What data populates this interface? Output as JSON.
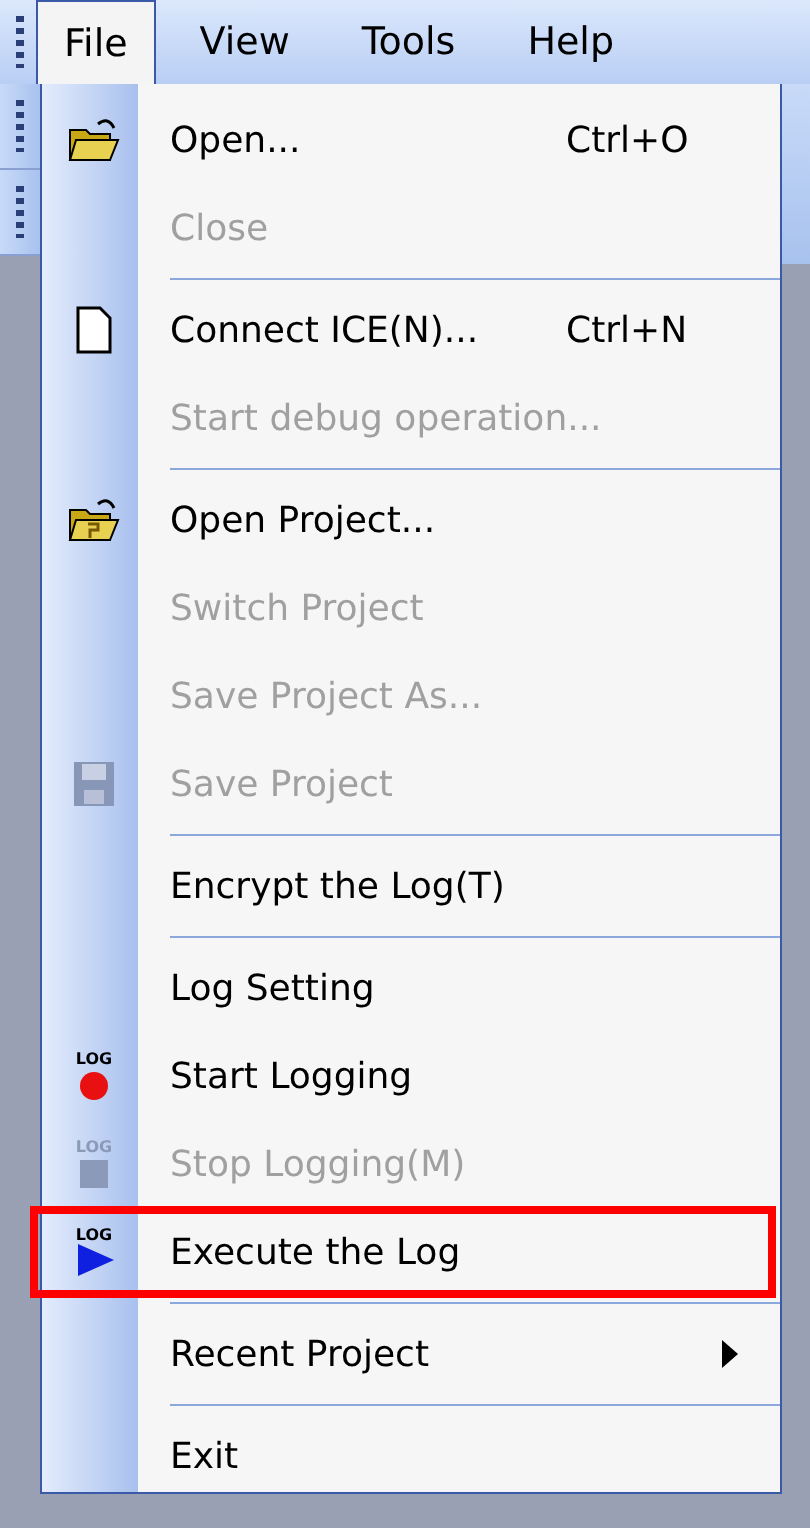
{
  "menu_bar": [
    {
      "label": "File",
      "selected": true
    },
    {
      "label": "View",
      "selected": false
    },
    {
      "label": "Tools",
      "selected": false
    },
    {
      "label": "Help",
      "selected": false
    }
  ],
  "file_menu": [
    {
      "kind": "item",
      "label": "Open...",
      "shortcut": "Ctrl+O",
      "disabled": false
    },
    {
      "kind": "item",
      "label": "Close",
      "disabled": true
    },
    {
      "kind": "separator"
    },
    {
      "kind": "item",
      "label": "Connect ICE(N)...",
      "shortcut": "Ctrl+N",
      "disabled": false
    },
    {
      "kind": "item",
      "label": "Start debug operation...",
      "disabled": true
    },
    {
      "kind": "separator"
    },
    {
      "kind": "item",
      "label": "Open Project...",
      "disabled": false
    },
    {
      "kind": "item",
      "label": "Switch Project",
      "disabled": true
    },
    {
      "kind": "item",
      "label": "Save Project As...",
      "disabled": true
    },
    {
      "kind": "item",
      "label": "Save Project",
      "disabled": true
    },
    {
      "kind": "separator"
    },
    {
      "kind": "item",
      "label": "Encrypt the Log(T)",
      "disabled": false
    },
    {
      "kind": "separator"
    },
    {
      "kind": "item",
      "label": "Log Setting",
      "disabled": false
    },
    {
      "kind": "item",
      "label": "Start Logging",
      "icon_text": "LOG",
      "disabled": false
    },
    {
      "kind": "item",
      "label": "Stop Logging(M)",
      "icon_text": "LOG",
      "disabled": true
    },
    {
      "kind": "item",
      "label": "Execute the Log",
      "icon_text": "LOG",
      "disabled": false,
      "highlighted": true
    },
    {
      "kind": "separator"
    },
    {
      "kind": "submenu",
      "label": "Recent Project",
      "disabled": false
    },
    {
      "kind": "separator"
    },
    {
      "kind": "item",
      "label": "Exit",
      "disabled": false
    }
  ]
}
